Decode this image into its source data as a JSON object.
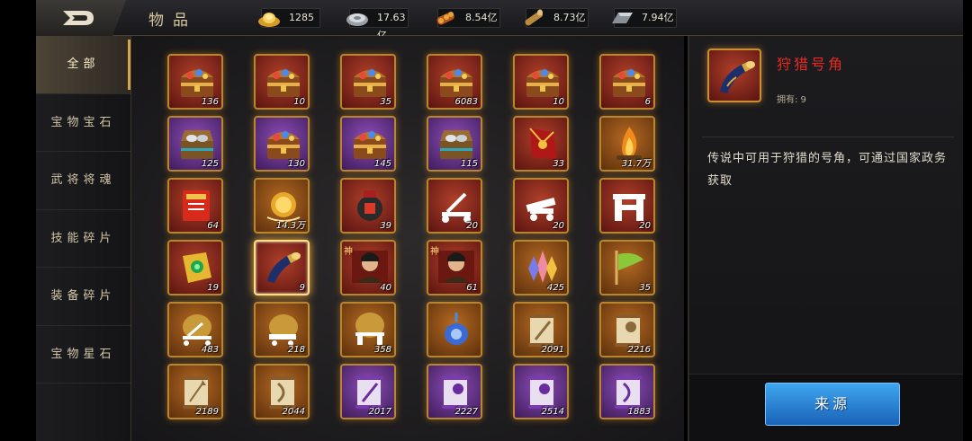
{
  "header": {
    "title": "物品",
    "back_icon": "back-arrow-icon"
  },
  "resources": [
    {
      "name": "gold-ingot",
      "icon": "gold-ingot-icon",
      "value": "1285"
    },
    {
      "name": "silver",
      "icon": "silver-icon",
      "value": "17.63亿"
    },
    {
      "name": "grain",
      "icon": "grain-icon",
      "value": "8.54亿"
    },
    {
      "name": "wood",
      "icon": "wood-icon",
      "value": "8.73亿"
    },
    {
      "name": "iron",
      "icon": "iron-icon",
      "value": "7.94亿"
    }
  ],
  "tabs": [
    {
      "label": "全部",
      "active": true
    },
    {
      "label": "宝物宝石",
      "active": false
    },
    {
      "label": "武将将魂",
      "active": false
    },
    {
      "label": "技能碎片",
      "active": false
    },
    {
      "label": "装备碎片",
      "active": false
    },
    {
      "label": "宝物星石",
      "active": false
    }
  ],
  "items": [
    {
      "icon": "treasure-chest-icon",
      "rarity": "red",
      "count": "136"
    },
    {
      "icon": "treasure-chest-icon",
      "rarity": "red",
      "count": "10"
    },
    {
      "icon": "treasure-chest-icon",
      "rarity": "red",
      "count": "35"
    },
    {
      "icon": "treasure-chest-icon",
      "rarity": "red",
      "count": "6083"
    },
    {
      "icon": "treasure-chest-icon",
      "rarity": "red",
      "count": "10"
    },
    {
      "icon": "treasure-chest-icon",
      "rarity": "red",
      "count": "6"
    },
    {
      "icon": "silver-chest-icon",
      "rarity": "purple",
      "count": "125"
    },
    {
      "icon": "treasure-chest-icon",
      "rarity": "purple",
      "count": "130"
    },
    {
      "icon": "treasure-chest-icon",
      "rarity": "purple",
      "count": "145"
    },
    {
      "icon": "silver-chest-icon",
      "rarity": "purple",
      "count": "115"
    },
    {
      "icon": "red-envelope-icon",
      "rarity": "red",
      "count": "33"
    },
    {
      "icon": "campfire-icon",
      "rarity": "orange",
      "count": "31.7万"
    },
    {
      "icon": "scroll-book-icon",
      "rarity": "red",
      "count": "64"
    },
    {
      "icon": "golden-orb-icon",
      "rarity": "orange",
      "count": "14.3万"
    },
    {
      "icon": "wine-jar-icon",
      "rarity": "red",
      "count": "39"
    },
    {
      "icon": "catapult-icon",
      "rarity": "red",
      "count": "20"
    },
    {
      "icon": "cannon-icon",
      "rarity": "red",
      "count": "20"
    },
    {
      "icon": "gate-tower-icon",
      "rarity": "red",
      "count": "20"
    },
    {
      "icon": "jade-token-icon",
      "rarity": "red",
      "count": "19"
    },
    {
      "icon": "hunting-horn-icon",
      "rarity": "red",
      "count": "9",
      "selected": true
    },
    {
      "icon": "general-portrait-icon",
      "rarity": "red",
      "count": "40",
      "badge": "神"
    },
    {
      "icon": "general-portrait-icon",
      "rarity": "red",
      "count": "61",
      "badge": "神"
    },
    {
      "icon": "crystal-cluster-icon",
      "rarity": "orange",
      "count": "425"
    },
    {
      "icon": "banner-flag-icon",
      "rarity": "orange",
      "count": "35"
    },
    {
      "icon": "catapult-bag-icon",
      "rarity": "orange",
      "count": "483"
    },
    {
      "icon": "cannon-bag-icon",
      "rarity": "orange",
      "count": "218"
    },
    {
      "icon": "gate-bag-icon",
      "rarity": "orange",
      "count": "358"
    },
    {
      "icon": "blue-pendant-icon",
      "rarity": "orange",
      "count": ""
    },
    {
      "icon": "scroll-sword-icon",
      "rarity": "orange",
      "count": "2091"
    },
    {
      "icon": "scroll-axe-icon",
      "rarity": "orange",
      "count": "2216"
    },
    {
      "icon": "scroll-spear-icon",
      "rarity": "orange",
      "count": "2189"
    },
    {
      "icon": "scroll-bow-icon",
      "rarity": "orange",
      "count": "2044"
    },
    {
      "icon": "purple-scroll-sword-icon",
      "rarity": "purple",
      "count": "2017"
    },
    {
      "icon": "purple-scroll-axe-icon",
      "rarity": "purple",
      "count": "2227"
    },
    {
      "icon": "purple-scroll-axe-icon",
      "rarity": "purple",
      "count": "2514"
    },
    {
      "icon": "purple-scroll-bow-icon",
      "rarity": "purple",
      "count": "1883"
    }
  ],
  "detail": {
    "name": "狩猎号角",
    "owned": "拥有: 9",
    "description": "传说中可用于狩猎的号角，可通过国家政务获取",
    "source_button": "来源",
    "icon": "hunting-horn-icon"
  }
}
